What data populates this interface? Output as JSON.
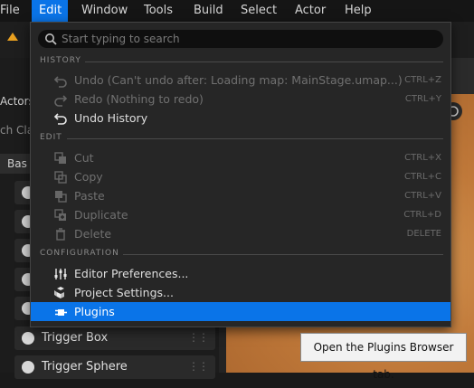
{
  "menubar": {
    "items": [
      "File",
      "Edit",
      "Window",
      "Tools",
      "Build",
      "Select",
      "Actor",
      "Help"
    ],
    "active": "Edit"
  },
  "left_panel": {
    "actors_tab": "Actors",
    "search_partial": "ch Cla",
    "tab_partial": "Bas",
    "items": [
      "Trigger Box",
      "Trigger Sphere"
    ]
  },
  "edit_menu": {
    "search_placeholder": "Start typing to search",
    "sections": {
      "history": "HISTORY",
      "edit": "EDIT",
      "configuration": "CONFIGURATION"
    },
    "history_items": [
      {
        "label": "Undo (Can't undo after: Loading map: MainStage.umap...)",
        "shortcut": "CTRL+Z",
        "icon": "undo-icon",
        "disabled": true
      },
      {
        "label": "Redo (Nothing to redo)",
        "shortcut": "CTRL+Y",
        "icon": "redo-icon",
        "disabled": true
      },
      {
        "label": "Undo History",
        "shortcut": "",
        "icon": "undo-history-icon",
        "disabled": false
      }
    ],
    "edit_items": [
      {
        "label": "Cut",
        "shortcut": "CTRL+X",
        "icon": "cut-icon",
        "disabled": true
      },
      {
        "label": "Copy",
        "shortcut": "CTRL+C",
        "icon": "copy-icon",
        "disabled": true
      },
      {
        "label": "Paste",
        "shortcut": "CTRL+V",
        "icon": "paste-icon",
        "disabled": true
      },
      {
        "label": "Duplicate",
        "shortcut": "CTRL+D",
        "icon": "duplicate-icon",
        "disabled": true
      },
      {
        "label": "Delete",
        "shortcut": "DELETE",
        "icon": "trash-icon",
        "disabled": true
      }
    ],
    "config_items": [
      {
        "label": "Editor Preferences...",
        "icon": "sliders-icon"
      },
      {
        "label": "Project Settings...",
        "icon": "cubes-icon"
      },
      {
        "label": "Plugins",
        "icon": "plug-icon",
        "highlighted": true
      }
    ]
  },
  "tooltip": "Open the Plugins Browser tab.",
  "colors": {
    "accent": "#0a74e8",
    "menu_bg": "#262626",
    "terrain": "#c0793a"
  }
}
